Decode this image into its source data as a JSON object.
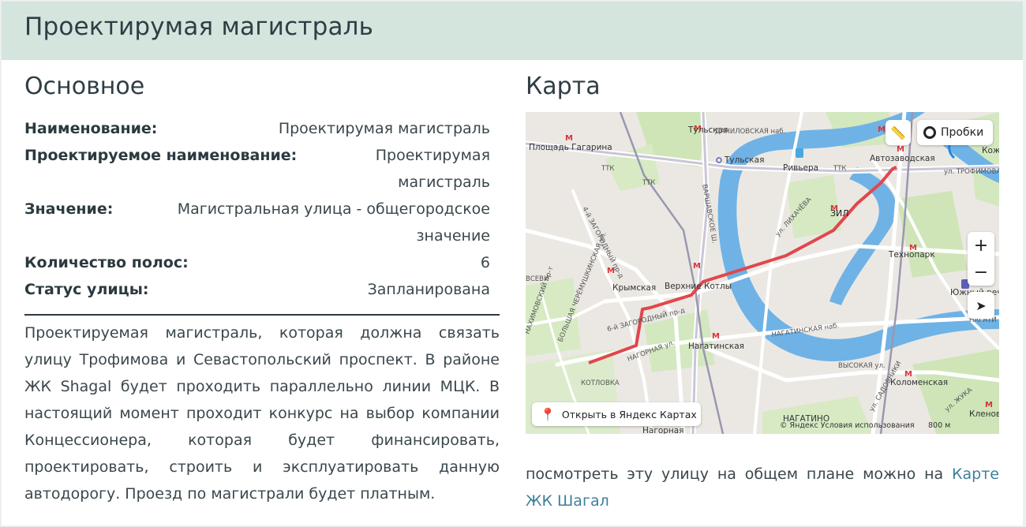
{
  "header": {
    "title": "Проектирумая магистраль"
  },
  "main": {
    "heading": "Основное",
    "properties": [
      {
        "key": "Наименование:",
        "value": "Проектирумая магистраль"
      },
      {
        "key": "Проектируемое наименование:",
        "value": "Проектирумая магистраль"
      },
      {
        "key": "Значение:",
        "value": "Магистральная улица - общегородское значение"
      },
      {
        "key": "Количество полос:",
        "value": "6"
      },
      {
        "key": "Статус улицы:",
        "value": "Запланирована"
      }
    ],
    "description": "Проектируемая магистраль, которая должна связать улицу Трофимова и Севастопольский проспект. В районе ЖК Shagal будет проходить параллельно линии МЦК. В настоящий момент проходит конкурс на выбор компании Концессионера, которая будет финансировать, проектировать, строить и эксплуатировать данную автодорогу. Проезд по магистрали будет платным."
  },
  "map_section": {
    "heading": "Карта",
    "traffic_label": "Пробки",
    "zoom_in": "+",
    "zoom_out": "−",
    "open_label": "Открыть в Яндекс Картах",
    "copyright": "© Яндекс   Условия использования",
    "scale_label": "800 м",
    "route_color": "#e0474c",
    "water_color": "#6fb2e6",
    "labels": {
      "ploshchad_gagarina": "Площадь Гагарина",
      "tulskaya_top": "Тульская",
      "tulskaya": "Тульская",
      "danilovskaya": "ДАНИЛОВСКАЯ наб.",
      "riviera": "Ривьера",
      "avtozavodskaya": "Автозаводская",
      "ttk1": "ТТК",
      "ttk2": "ТТК",
      "ttk3": "ТТК",
      "trofimova": "ул. ТРОФИМОВА",
      "kozh": "Кож",
      "zil": "ЗИЛ",
      "lihacheva": "ул. ЛИХАЧЁВА",
      "varshavskoe": "ВАРШАВСКОЕ Ш.",
      "zagorodny4": "4-й ЗАГОРОДНЫЙ пр-д",
      "tekhnopark": "Технопарк",
      "krymskaya": "Крымская",
      "verkhnie_kotly": "Верхние Котлы",
      "yuzhny": "Южный речной вокз",
      "nagatinskaya": "Нагатинская",
      "nagatinskaya_nab": "НАГАТИНСКАЯ наб.",
      "nagatino_top": "НАГАТИ ЗАТ",
      "zagorodny6": "6-й ЗАГОРОДНЫЙ пр-д",
      "nagornaya_ul": "НАГОРНАЯ ул.",
      "kotlovka": "КОТЛОВКА",
      "vysokaya": "ВЫСОКАЯ ул.",
      "kolomenskaya": "Коломенская",
      "sadovniki": "ул. САДОВНИКИ",
      "nagatino": "НАГАТИНО",
      "nagornaya": "Нагорная",
      "klenovy": "Кленов бульв",
      "vsevi": "ВСЕВИ",
      "cheremushkinskaya": "БОЛЬШАЯ ЧЕРЁМУШКИНСКАЯ ул.",
      "nakhimovsky": "НАХИМОВСКИЙ пр-т",
      "zhuka": "ул. ЖУКА"
    }
  },
  "footer_note": {
    "text": "посмотреть эту улицу на общем плане можно на ",
    "link": "Карте ЖК Шагал"
  }
}
